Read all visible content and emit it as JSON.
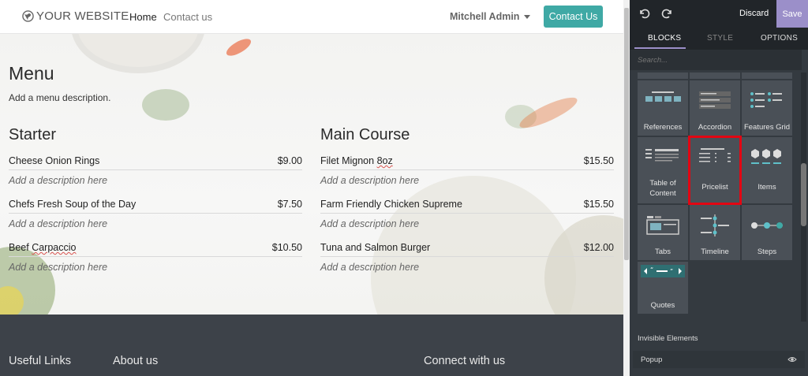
{
  "navbar": {
    "brand": "YOUR WEBSITE",
    "links": [
      "Home",
      "Contact us"
    ],
    "user": "Mitchell Admin",
    "cta": "Contact Us"
  },
  "menu": {
    "title": "Menu",
    "description": "Add a menu description.",
    "starter": {
      "title": "Starter",
      "items": [
        {
          "name": "Cheese Onion Rings",
          "price": "$9.00",
          "desc": "Add a description here"
        },
        {
          "name": "Chefs Fresh Soup of the Day",
          "price": "$7.50",
          "desc": "Add a description here"
        },
        {
          "name": "Beef Carpaccio",
          "price": "$10.50",
          "desc": "Add a description here"
        }
      ]
    },
    "main": {
      "title": "Main Course",
      "items": [
        {
          "name": "Filet Mignon 8oz",
          "price": "$15.50",
          "desc": "Add a description here"
        },
        {
          "name": "Farm Friendly Chicken Supreme",
          "price": "$15.50",
          "desc": "Add a description here"
        },
        {
          "name": "Tuna and Salmon Burger",
          "price": "$12.00",
          "desc": "Add a description here"
        }
      ]
    }
  },
  "footer": {
    "headings": [
      "Useful Links",
      "About us",
      "Connect with us"
    ]
  },
  "panel": {
    "discard": "Discard",
    "save": "Save",
    "tabs": [
      "BLOCKS",
      "STYLE",
      "OPTIONS"
    ],
    "search_placeholder": "Search...",
    "blocks": [
      "References",
      "Accordion",
      "Features Grid",
      "Table of Content",
      "Pricelist",
      "Items",
      "Tabs",
      "Timeline",
      "Steps",
      "Quotes"
    ],
    "selected_block": "Pricelist",
    "invisible_heading": "Invisible Elements",
    "invisible_items": [
      "Popup"
    ]
  },
  "colors": {
    "accent_teal": "#3fa9a5",
    "save_purple": "#9b8fc9",
    "selection_red": "#e30613",
    "footer_bg": "#3d4249",
    "panel_bg": "#343a40"
  }
}
